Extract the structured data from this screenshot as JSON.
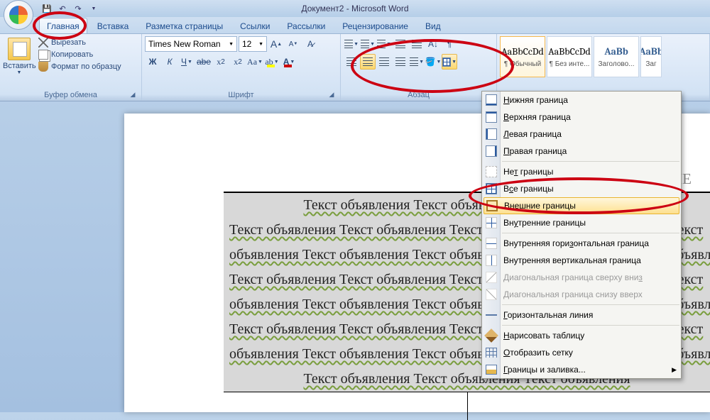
{
  "app": {
    "title": "Документ2 - Microsoft Word"
  },
  "tabs": {
    "home": "Главная",
    "insert": "Вставка",
    "pagelayout": "Разметка страницы",
    "references": "Ссылки",
    "mailings": "Рассылки",
    "review": "Рецензирование",
    "view": "Вид"
  },
  "clipboard": {
    "paste": "Вставить",
    "cut": "Вырезать",
    "copy": "Копировать",
    "format_painter": "Формат по образцу",
    "group": "Буфер обмена"
  },
  "font": {
    "name": "Times New Roman",
    "size": "12",
    "group": "Шрифт"
  },
  "paragraph": {
    "group": "Абзац"
  },
  "styles": {
    "preview": "AaBbCcDd",
    "preview_h": "AaBb",
    "normal": "¶ Обычный",
    "nospacing": "¶ Без инте...",
    "heading1": "Заголово...",
    "heading2": "Заг"
  },
  "border_menu": {
    "bottom": "Нижняя граница",
    "top": "Верхняя граница",
    "left": "Левая граница",
    "right": "Правая граница",
    "none": "Нет границы",
    "all": "Все границы",
    "outside": "Внешние границы",
    "inside": "Внутренние границы",
    "inside_h": "Внутренняя горизонтальная граница",
    "inside_v": "Внутренняя вертикальная граница",
    "diag_down": "Диагональная граница сверху вниз",
    "diag_up": "Диагональная граница снизу вверх",
    "hline": "Горизонтальная линия",
    "draw": "Нарисовать таблицу",
    "grid": "Отобразить сетку",
    "borders_shading": "Границы и заливка..."
  },
  "document": {
    "header": "ОБЪЯВЛЕНИЕ",
    "line_full": "Текст объявления  Текст объявления  Текст объявления  Текст объявления  Текст",
    "line_wrap": "объявления  Текст объявления  Текст объявления  Текст объявления  Текст объявления",
    "line_center": "Текст объявления  Текст объявления  Текст объявления"
  }
}
